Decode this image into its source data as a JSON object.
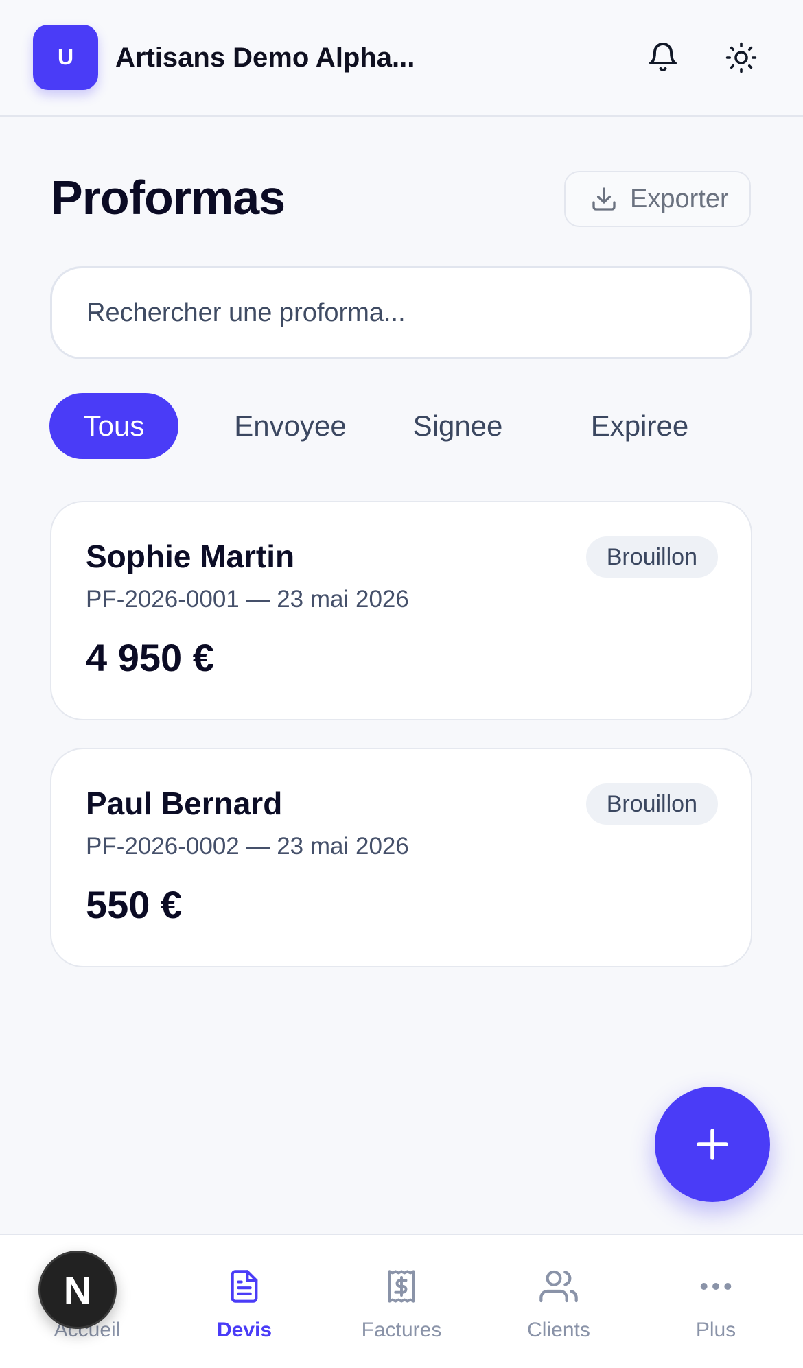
{
  "header": {
    "avatar_letter": "U",
    "org_name": "Artisans Demo Alpha..."
  },
  "page": {
    "title": "Proformas",
    "export_label": "Exporter"
  },
  "search": {
    "placeholder": "Rechercher une proforma..."
  },
  "filters": [
    "Tous",
    "Envoyee",
    "Signee",
    "Expiree"
  ],
  "proformas": [
    {
      "client": "Sophie Martin",
      "ref": "PF-2026-0001 — 23 mai 2026",
      "amount": "4 950 €",
      "status": "Brouillon"
    },
    {
      "client": "Paul Bernard",
      "ref": "PF-2026-0002 — 23 mai 2026",
      "amount": "550 €",
      "status": "Brouillon"
    }
  ],
  "bottom_nav": [
    {
      "label": "Accueil",
      "icon": "home-icon"
    },
    {
      "label": "Devis",
      "icon": "document-icon"
    },
    {
      "label": "Factures",
      "icon": "receipt-icon"
    },
    {
      "label": "Clients",
      "icon": "users-icon"
    },
    {
      "label": "Plus",
      "icon": "more-icon"
    }
  ],
  "dev_badge": "N",
  "colors": {
    "accent": "#4a3cf7",
    "text": "#0f1020",
    "muted": "#45506a",
    "badge_bg": "#eef1f6"
  }
}
